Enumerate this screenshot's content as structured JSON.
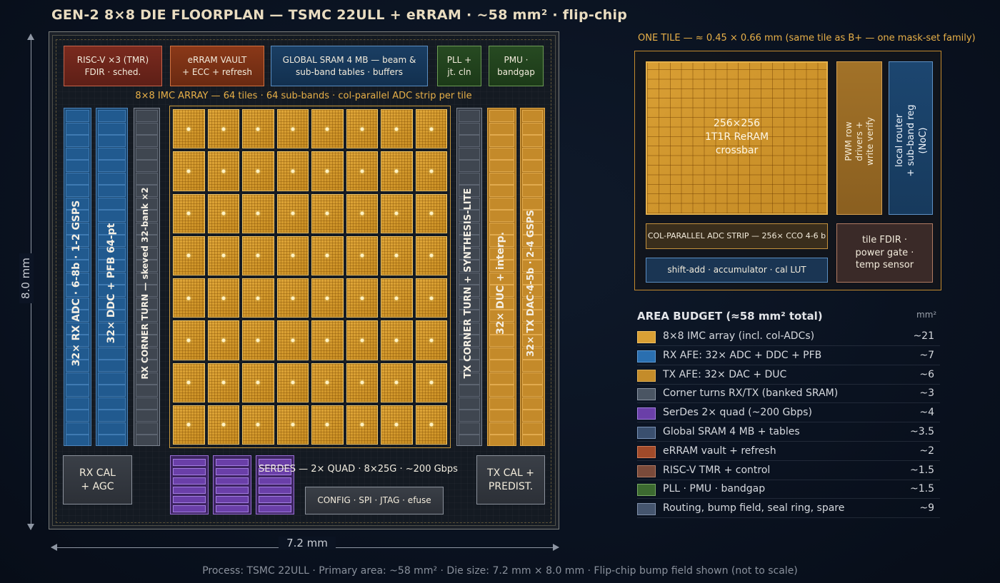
{
  "title": "GEN-2 8×8 DIE FLOORPLAN — TSMC 22ULL + eRRAM · ~58 mm² · flip-chip",
  "dimensions": {
    "height_label": "8.0 mm",
    "width_label": "7.2 mm"
  },
  "die": {
    "top_blocks": {
      "riscv": [
        "RISC-V ×3 (TMR)",
        "FDIR · sched."
      ],
      "erram": [
        "eRRAM VAULT",
        "+ ECC + refresh"
      ],
      "sram": [
        "GLOBAL SRAM 4 MB — beam &",
        "sub-band tables · buffers"
      ],
      "pll": [
        "PLL +",
        "jt. cln"
      ],
      "pmu": [
        "PMU ·",
        "bandgap"
      ]
    },
    "array_label": "8×8 IMC ARRAY — 64 tiles · 64 sub-bands · col-parallel ADC strip per tile",
    "array": {
      "rows": 8,
      "cols": 8
    },
    "stripes": {
      "rx_adc": "32× RX ADC · 6-8b · 1-2 GSPS",
      "rx_ddc": "32× DDC + PFB 64-pt",
      "rx_corner": "RX CORNER TURN — skeved 32-bank ×2",
      "tx_corner": "TX CORNER TURN + SYNTHESIS-LITE",
      "tx_duc": "32× DUC + interp.",
      "tx_dac": "32× TX DAC·4-5b · 2-4 GSPS"
    },
    "bottom": {
      "rx_cal": [
        "RX CAL",
        "+ AGC"
      ],
      "serdes": "SERDES — 2× QUAD · 8×25G · ~200 Gbps",
      "config": "CONFIG · SPI · JTAG · efuse",
      "tx_cal": [
        "TX CAL +",
        "PREDIST."
      ]
    }
  },
  "tile_detail": {
    "title": "ONE TILE — ≈ 0.45 × 0.66 mm  (same tile as B+ — one mask-set family)",
    "crossbar": [
      "256×256",
      "1T1R ReRAM",
      "crossbar"
    ],
    "pwm": [
      "PWM row",
      "drivers +",
      "write verify"
    ],
    "router": [
      "local router",
      "+ sub-band reg",
      "(NoC)"
    ],
    "adc_strip": "COL-PARALLEL ADC STRIP — 256× CCO 4-6 b",
    "shift_add": "shift-add · accumulator · cal LUT",
    "fdir": [
      "tile FDIR ·",
      "power gate ·",
      "temp sensor"
    ]
  },
  "budget": {
    "title": "AREA BUDGET (≈58 mm² total)",
    "unit": "mm²",
    "rows": [
      {
        "label": "8×8 IMC array (incl. col-ADCs)",
        "value": "~21",
        "color": "#d9a035",
        "border": "#f0c060"
      },
      {
        "label": "RX AFE: 32× ADC + DDC + PFB",
        "value": "~7",
        "color": "#2a6fb0",
        "border": "#5e9ad3"
      },
      {
        "label": "TX AFE: 32× DAC + DUC",
        "value": "~6",
        "color": "#c48c2a",
        "border": "#e0b055"
      },
      {
        "label": "Corner turns RX/TX (banked SRAM)",
        "value": "~3",
        "color": "#4a5563",
        "border": "#8a94a2"
      },
      {
        "label": "SerDes 2× quad (~200 Gbps)",
        "value": "~4",
        "color": "#6a3fa8",
        "border": "#a37ee0"
      },
      {
        "label": "Global SRAM 4 MB + tables",
        "value": "~3.5",
        "color": "#3a4f6e",
        "border": "#7891b5"
      },
      {
        "label": "eRRAM vault + refresh",
        "value": "~2",
        "color": "#a04a2a",
        "border": "#d27a55"
      },
      {
        "label": "RISC-V TMR + control",
        "value": "~1.5",
        "color": "#7a4a3a",
        "border": "#b27a62"
      },
      {
        "label": "PLL · PMU · bandgap",
        "value": "~1.5",
        "color": "#3c6a30",
        "border": "#78a862"
      },
      {
        "label": "Routing, bump field, seal ring, spare",
        "value": "~9",
        "color": "#45556e",
        "border": "#8090aa"
      }
    ]
  },
  "footer": "Process: TSMC 22ULL   ·   Primary area: ~58 mm²   ·   Die size: 7.2 mm × 8.0 mm   ·   Flip-chip bump field shown (not to scale)"
}
